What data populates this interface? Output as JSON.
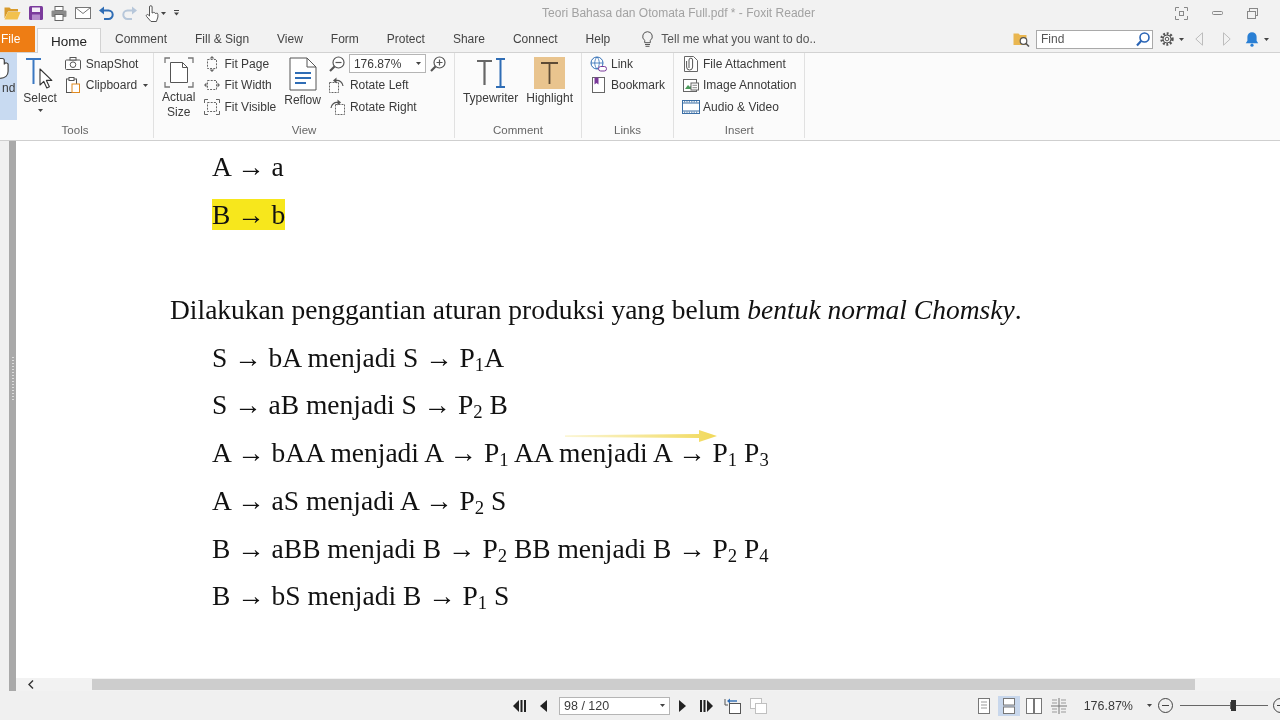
{
  "window": {
    "title": "Teori Bahasa dan Otomata Full.pdf * - Foxit Reader"
  },
  "menu_tabs": [
    {
      "label": "File",
      "kind": "file",
      "selected": false
    },
    {
      "label": "Home",
      "kind": "tab",
      "selected": true
    },
    {
      "label": "Comment",
      "kind": "tab",
      "selected": false
    },
    {
      "label": "Fill & Sign",
      "kind": "tab",
      "selected": false
    },
    {
      "label": "View",
      "kind": "tab",
      "selected": false
    },
    {
      "label": "Form",
      "kind": "tab",
      "selected": false
    },
    {
      "label": "Protect",
      "kind": "tab",
      "selected": false
    },
    {
      "label": "Share",
      "kind": "tab",
      "selected": false
    },
    {
      "label": "Connect",
      "kind": "tab",
      "selected": false
    },
    {
      "label": "Help",
      "kind": "tab",
      "selected": false
    }
  ],
  "tell_me": {
    "placeholder": "Tell me what you want to do.."
  },
  "find": {
    "placeholder": "Find"
  },
  "ribbon": {
    "groups": [
      {
        "label": "Tools",
        "columns": [
          [
            {
              "kind": "large",
              "label": "nd",
              "selected": true,
              "dropdown": false
            }
          ],
          [
            {
              "kind": "large",
              "label": "Select",
              "selected": false,
              "dropdown": true
            }
          ],
          [
            {
              "kind": "small",
              "label": "SnapShot",
              "selected": false,
              "dropdown": false
            },
            {
              "kind": "small",
              "label": "Clipboard",
              "selected": false,
              "dropdown": true
            }
          ]
        ]
      },
      {
        "label": "View",
        "columns": [
          [
            {
              "kind": "large",
              "label": "Actual Size",
              "selected": false,
              "dropdown": false
            }
          ],
          [
            {
              "kind": "small",
              "label": "Fit Page",
              "selected": false,
              "dropdown": false
            },
            {
              "kind": "small",
              "label": "Fit Width",
              "selected": false,
              "dropdown": false
            },
            {
              "kind": "small",
              "label": "Fit Visible",
              "selected": false,
              "dropdown": false
            }
          ],
          [
            {
              "kind": "large",
              "label": "Reflow",
              "selected": false,
              "dropdown": false
            }
          ],
          [
            {
              "kind": "zoom",
              "value": "176.87%",
              "dropdown": true
            },
            {
              "kind": "small",
              "label": "Rotate Left",
              "selected": false,
              "dropdown": false
            },
            {
              "kind": "small",
              "label": "Rotate Right",
              "selected": false,
              "dropdown": false
            }
          ]
        ]
      },
      {
        "label": "Comment",
        "columns": [
          [
            {
              "kind": "large",
              "label": "Typewriter",
              "selected": false,
              "dropdown": false
            }
          ],
          [
            {
              "kind": "large",
              "label": "Highlight",
              "selected": false,
              "dropdown": false
            }
          ]
        ]
      },
      {
        "label": "Links",
        "columns": [
          [
            {
              "kind": "small",
              "label": "Link",
              "selected": false,
              "dropdown": false
            },
            {
              "kind": "small",
              "label": "Bookmark",
              "selected": false,
              "dropdown": false
            }
          ]
        ]
      },
      {
        "label": "Insert",
        "columns": [
          [
            {
              "kind": "small",
              "label": "File Attachment",
              "selected": false,
              "dropdown": false
            },
            {
              "kind": "small",
              "label": "Image Annotation",
              "selected": false,
              "dropdown": false
            },
            {
              "kind": "small",
              "label": "Audio & Video",
              "selected": false,
              "dropdown": false
            }
          ]
        ]
      }
    ]
  },
  "page": {
    "lines": [
      {
        "kind": "rule",
        "text": "A → a",
        "highlighted": false,
        "arrow_mark": false
      },
      {
        "kind": "rule",
        "text": "B → b",
        "highlighted": true,
        "arrow_mark": false
      },
      {
        "kind": "paragraph",
        "text": "Dilakukan penggantian aturan produksi yang belum *bentuk normal Chomsky*.",
        "highlighted": false,
        "arrow_mark": false
      },
      {
        "kind": "rule",
        "text": "S → bA menjadi S → P$_{1}$A",
        "highlighted": false,
        "arrow_mark": false
      },
      {
        "kind": "rule",
        "text": "S → aB menjadi S → P$_{2}$ B",
        "highlighted": false,
        "arrow_mark": false
      },
      {
        "kind": "rule",
        "text": "A → bAA menjadi A → P$_{1}$ AA menjadi A → P$_{1}$ P$_{3}$",
        "highlighted": false,
        "arrow_mark": true
      },
      {
        "kind": "rule",
        "text": "A → aS menjadi A → P$_{2}$ S",
        "highlighted": false,
        "arrow_mark": false
      },
      {
        "kind": "rule",
        "text": "B → aBB menjadi B → P$_{2}$ BB menjadi B → P$_{2}$ P$_{4}$",
        "highlighted": false,
        "arrow_mark": false
      },
      {
        "kind": "rule",
        "text": "B → bS menjadi B → P$_{1}$ S",
        "highlighted": false,
        "arrow_mark": false
      }
    ]
  },
  "status_bar": {
    "page": {
      "value": "98 / 120"
    },
    "view_modes": [
      {
        "selected": false
      },
      {
        "selected": true
      },
      {
        "selected": false
      },
      {
        "selected": false
      }
    ],
    "zoom": {
      "value": "176.87%"
    },
    "zoom_slider": {
      "level": 0.6
    }
  }
}
